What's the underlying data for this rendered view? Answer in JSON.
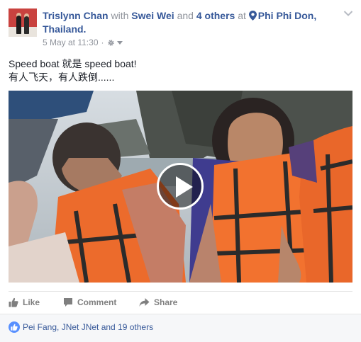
{
  "post": {
    "author": "Trislynn Chan",
    "with_prefix": "with",
    "tagged_friend": "Swei Wei",
    "and_word": "and",
    "others_link": "4 others",
    "at_word": "at",
    "location": "Phi Phi Don, Thailand.",
    "timestamp": "5 May at 11:30",
    "separator": "·",
    "text_line1": "Speed boat 就是 speed boat!",
    "text_line2": "有人飞天，有人跌倒......"
  },
  "actions": {
    "like_label": "Like",
    "comment_label": "Comment",
    "share_label": "Share"
  },
  "reactions": {
    "likers_text": "Pei Fang, JNet JNet and 19 others"
  },
  "icons": {
    "avatar": "profile-photo",
    "location": "map-pin-icon",
    "privacy": "gear-icon",
    "menu": "chevron-down-icon",
    "play": "play-icon",
    "like": "thumbs-up-icon",
    "comment": "speech-bubble-icon",
    "share": "share-arrow-icon",
    "reaction": "like-badge-icon"
  },
  "colors": {
    "link": "#365899",
    "secondary_text": "#90949c",
    "action_text": "#7f7f7f",
    "like_badge": "#5890ff",
    "reactions_bg": "#f6f7f9"
  }
}
